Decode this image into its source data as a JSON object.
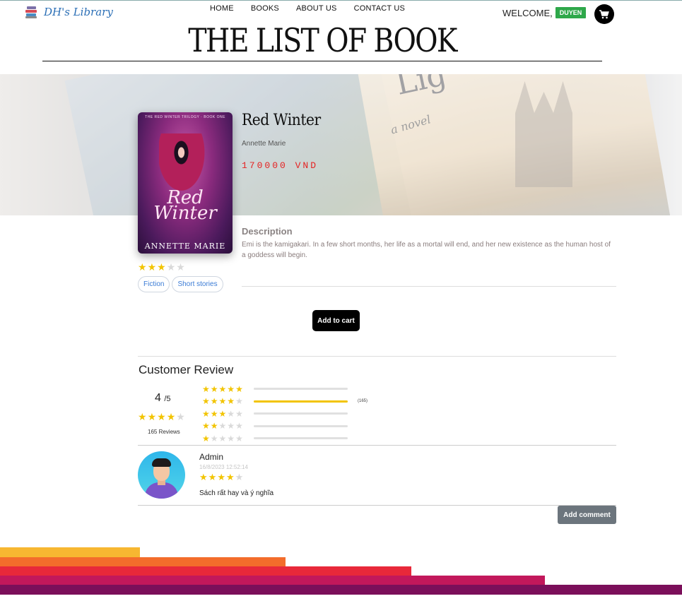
{
  "header": {
    "logo_text": "DH's Library",
    "nav": [
      "HOME",
      "BOOKS",
      "ABOUT US",
      "CONTACT US"
    ],
    "welcome_text": "WELCOME,",
    "username": "DUYEN",
    "cart_icon": "shopping-cart-icon"
  },
  "page_title": "THE LIST OF BOOK",
  "book": {
    "title": "Red Winter",
    "author": "Annette Marie",
    "price": "170000 VND",
    "cover": {
      "series_line": "THE RED WINTER TRILOGY · BOOK ONE",
      "title": "Red Winter",
      "author": "ANNETTE MARIE"
    },
    "rating": 3,
    "rating_max": 5,
    "tags": [
      "Fiction",
      "Short stories"
    ],
    "description_heading": "Description",
    "description": "Emi is the kamigakari. In a few short months, her life as a mortal will end, and her new existence as the human host of a goddess will begin."
  },
  "add_to_cart_label": "Add to cart",
  "reviews": {
    "heading": "Customer Review",
    "average": "4",
    "average_suffix": "/5",
    "average_stars": 4,
    "count_label": "165 Reviews",
    "distribution": [
      {
        "stars": 5,
        "fraction": 0,
        "count": ""
      },
      {
        "stars": 4,
        "fraction": 1,
        "count": "(165)"
      },
      {
        "stars": 3,
        "fraction": 0,
        "count": ""
      },
      {
        "stars": 2,
        "fraction": 0,
        "count": ""
      },
      {
        "stars": 1,
        "fraction": 0,
        "count": ""
      }
    ],
    "comments": [
      {
        "user": "Admin",
        "time": "16/8/2023 12:52:14",
        "stars": 4,
        "text": "Sách rất hay và ý nghĩa"
      }
    ]
  },
  "add_comment_label": "Add comment",
  "colors": {
    "accent_green": "#2ea84a",
    "price_red": "#e52121",
    "star_gold": "#f2c400",
    "footer_stripes": [
      "#f7b731",
      "#f36c2b",
      "#e8283a",
      "#c2185b",
      "#7b0f5a"
    ]
  }
}
